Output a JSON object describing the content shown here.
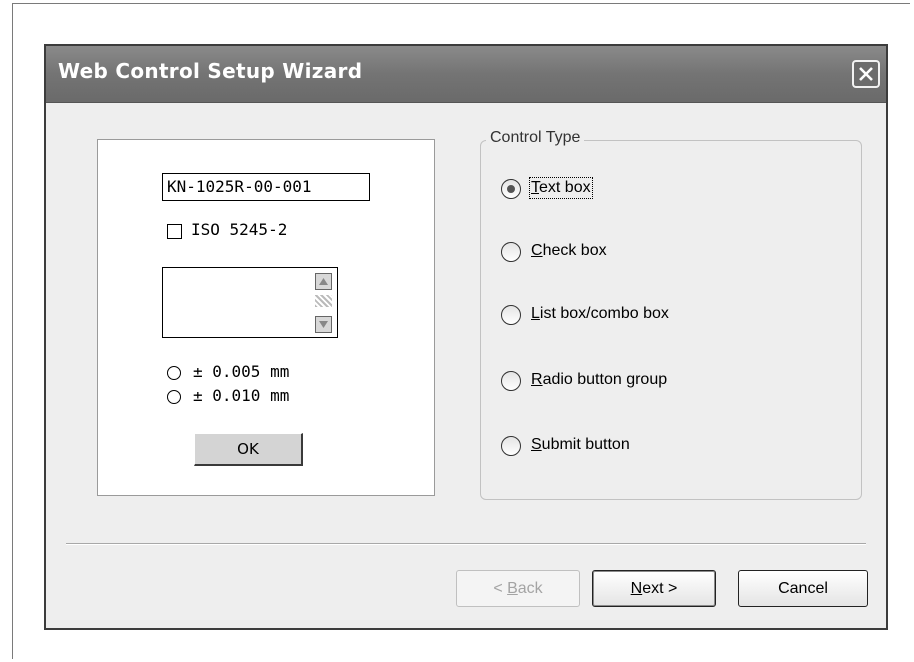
{
  "window": {
    "title": "Web Control Setup Wizard",
    "close_icon": "close-icon"
  },
  "preview": {
    "part_number": "KN-1025R-00-001",
    "iso_checkbox": {
      "label": "ISO 5245-2",
      "checked": false
    },
    "listbox": {
      "items": [],
      "scroll_up_icon": "scroll-up-icon",
      "scroll_down_icon": "scroll-down-icon"
    },
    "tolerance_options": [
      {
        "label": "± 0.005 mm",
        "selected": false
      },
      {
        "label": "± 0.010 mm",
        "selected": false
      }
    ],
    "ok_label": "OK"
  },
  "control_type": {
    "legend": "Control Type",
    "options": [
      {
        "accel": "T",
        "rest": "ext box",
        "selected": true,
        "focused": true
      },
      {
        "accel": "C",
        "rest": "heck box",
        "selected": false
      },
      {
        "accel": "L",
        "rest": "ist box/combo box",
        "selected": false
      },
      {
        "accel": "R",
        "rest": "adio button group",
        "selected": false
      },
      {
        "accel": "S",
        "rest": "ubmit button",
        "selected": false
      }
    ]
  },
  "footer": {
    "back": {
      "pre": "< ",
      "accel": "B",
      "rest": "ack",
      "enabled": false
    },
    "next": {
      "pre": "",
      "accel": "N",
      "rest": "ext >",
      "enabled": true
    },
    "cancel": "Cancel"
  },
  "colors": {
    "titlebar": "#747474",
    "dialog_bg": "#eeeeee",
    "disabled_text": "#a4a4a4"
  }
}
